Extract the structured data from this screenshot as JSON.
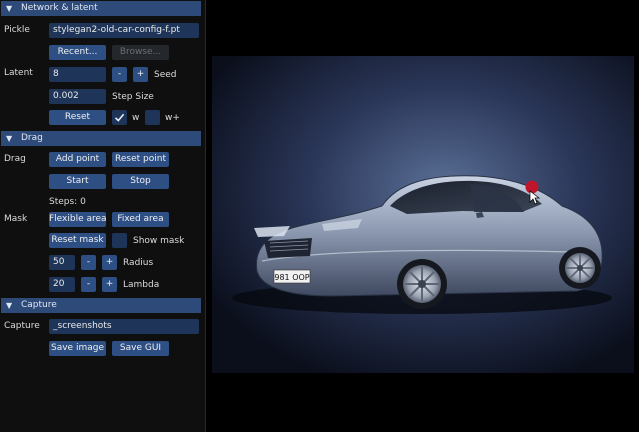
{
  "sections": {
    "network": "Network & latent",
    "drag": "Drag",
    "capture": "Capture"
  },
  "network": {
    "pickle_label": "Pickle",
    "pickle_value": "stylegan2-old-car-config-f.pt",
    "recent_button": "Recent...",
    "browse_button": "Browse...",
    "latent_label": "Latent",
    "seed_value": "8",
    "minus": "-",
    "plus": "+",
    "seed_label": "Seed",
    "step_value": "0.002",
    "step_label": "Step Size",
    "reset_button": "Reset",
    "w_label": "w",
    "wplus_label": "w+"
  },
  "drag": {
    "drag_label": "Drag",
    "add_point": "Add point",
    "reset_point": "Reset point",
    "start": "Start",
    "stop": "Stop",
    "steps": "Steps: 0",
    "mask_label": "Mask",
    "flexible_area": "Flexible area",
    "fixed_area": "Fixed area",
    "reset_mask": "Reset mask",
    "show_mask": "Show mask",
    "radius_value": "50",
    "radius_label": "Radius",
    "lambda_value": "20",
    "lambda_label": "Lambda"
  },
  "capture": {
    "capture_label": "Capture",
    "path_value": "_screenshots",
    "save_image": "Save image",
    "save_gui": "Save GUI"
  },
  "viewer": {
    "plate_text": "981 OOP"
  },
  "colors": {
    "header": "#2d4a78",
    "button": "#2d4f84",
    "input": "#1e3559",
    "drag_point": "#c0152a"
  }
}
